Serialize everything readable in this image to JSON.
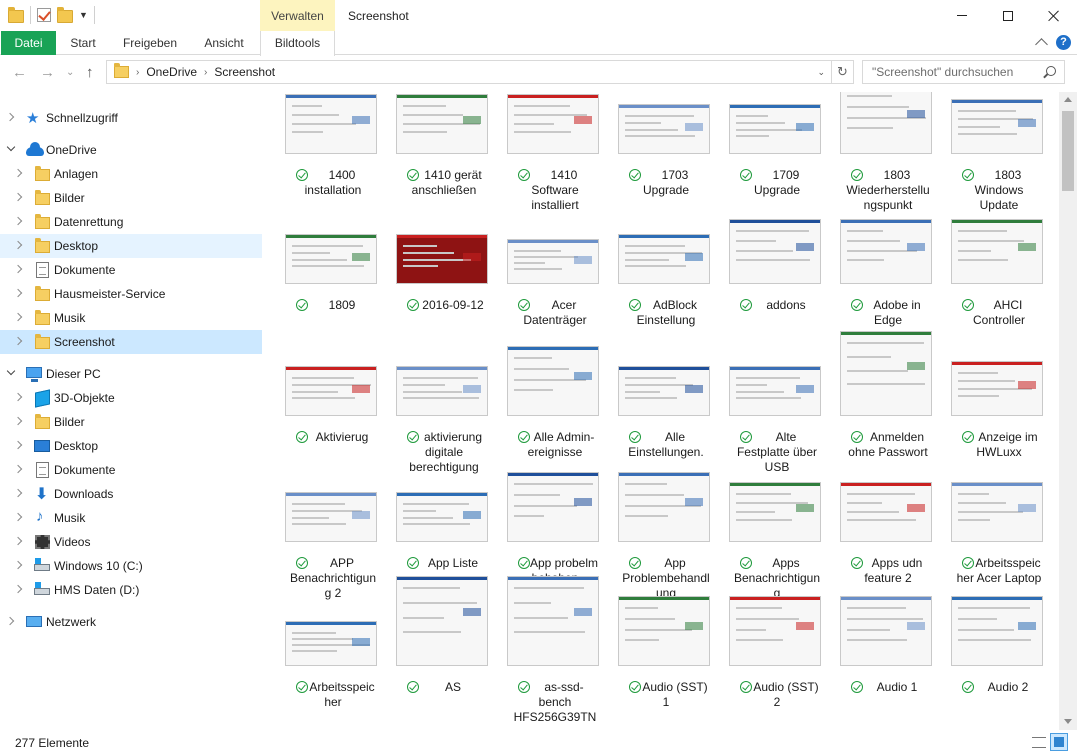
{
  "window": {
    "title": "Screenshot",
    "context_tab_group": "Verwalten"
  },
  "ribbon": {
    "tabs": [
      "Datei",
      "Start",
      "Freigeben",
      "Ansicht",
      "Bildtools"
    ],
    "accent_color": "#19a356"
  },
  "address": {
    "path": [
      "OneDrive",
      "Screenshot"
    ],
    "search_placeholder": "\"Screenshot\" durchsuchen"
  },
  "sidebar": {
    "items": [
      {
        "label": "Schnellzugriff",
        "icon": "star-icon"
      },
      {
        "label": "OneDrive",
        "icon": "cloud-icon"
      },
      {
        "label": "Anlagen",
        "icon": "folder-icon"
      },
      {
        "label": "Bilder",
        "icon": "folder-icon"
      },
      {
        "label": "Datenrettung",
        "icon": "folder-icon"
      },
      {
        "label": "Desktop",
        "icon": "folder-icon"
      },
      {
        "label": "Dokumente",
        "icon": "document-icon"
      },
      {
        "label": "Hausmeister-Service",
        "icon": "folder-icon"
      },
      {
        "label": "Musik",
        "icon": "folder-icon"
      },
      {
        "label": "Screenshot",
        "icon": "folder-icon",
        "selected": true
      },
      {
        "label": "Dieser PC",
        "icon": "computer-icon"
      },
      {
        "label": "3D-Objekte",
        "icon": "cube-icon"
      },
      {
        "label": "Bilder",
        "icon": "folder-icon"
      },
      {
        "label": "Desktop",
        "icon": "desktop-icon"
      },
      {
        "label": "Dokumente",
        "icon": "document-icon"
      },
      {
        "label": "Downloads",
        "icon": "download-icon"
      },
      {
        "label": "Musik",
        "icon": "music-icon"
      },
      {
        "label": "Videos",
        "icon": "video-icon"
      },
      {
        "label": "Windows 10 (C:)",
        "icon": "drive-icon"
      },
      {
        "label": "HMS Daten (D:)",
        "icon": "drive-icon"
      },
      {
        "label": "Netzwerk",
        "icon": "network-icon"
      }
    ]
  },
  "files": [
    "1400 installation",
    "1410 gerät anschließen",
    "1410 Software installiert",
    "1703 Upgrade",
    "1709 Upgrade",
    "1803 Wiederherstellungspunkt",
    "1803 Windows Update",
    "1809",
    "2016-09-12",
    "Acer Datenträger",
    "AdBlock Einstellung",
    "addons",
    "Adobe in Edge",
    "AHCI Controller",
    "Aktivierug",
    "aktivierung digitale berechtigung",
    "Alle Admin­ereignisse",
    "Alle Einstellungen.",
    "Alte Festplatte über USB",
    "Anmelden ohne Passwort",
    "Anzeige im HWLuxx",
    "APP Benachrichtigung 2",
    "App Liste",
    "App probelm behoben",
    "App Problembehandlung",
    "Apps Benachrichtigung",
    "Apps udn feature 2",
    "Arbeitsspeicher Acer Laptop",
    "Arbeitsspeicher",
    "AS",
    "as-ssd-bench HFS256G39TN",
    "Audio (SST) 1",
    "Audio (SST) 2",
    "Audio 1",
    "Audio 2"
  ],
  "status": {
    "item_count": "277 Elemente"
  }
}
